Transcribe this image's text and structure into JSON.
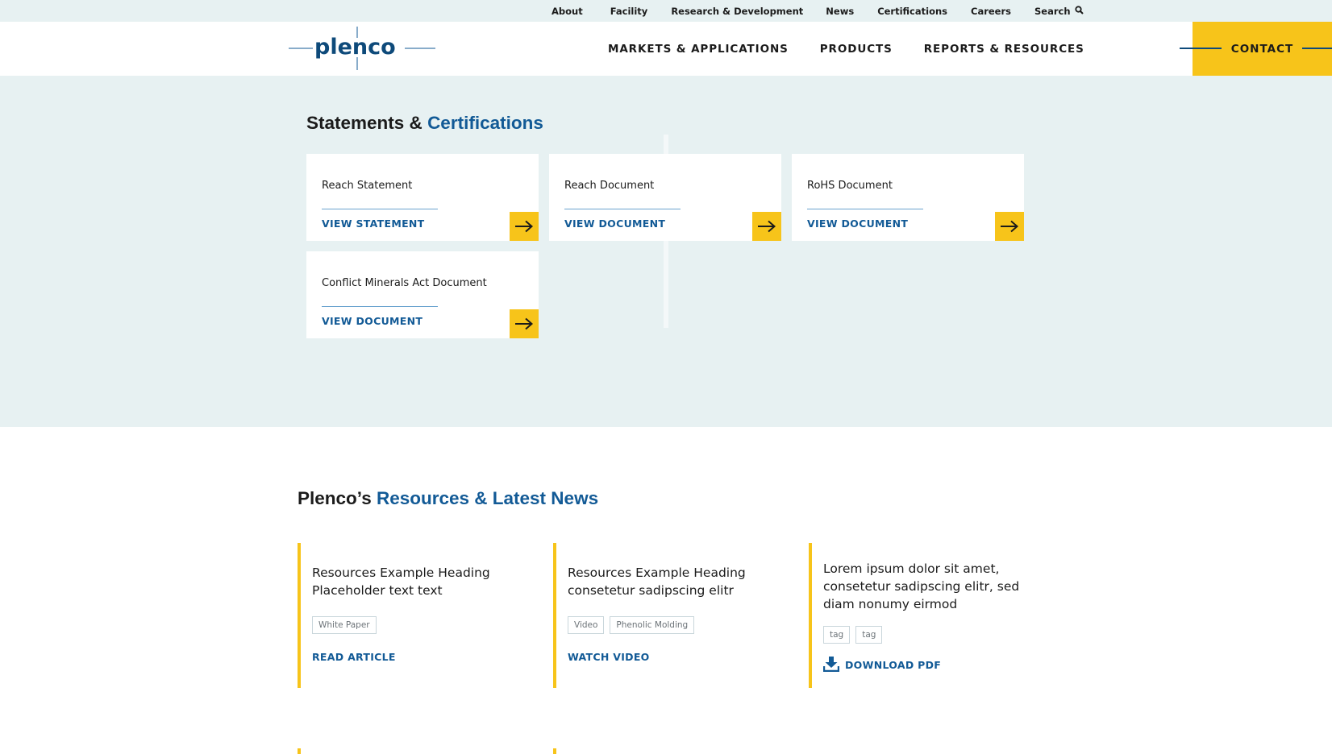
{
  "utility_nav": {
    "items": [
      "About",
      "Facility",
      "Research & Development",
      "News",
      "Certifications",
      "Careers"
    ],
    "search_label": "Search"
  },
  "header": {
    "logo_text": "plenco",
    "nav": [
      "MARKETS & APPLICATIONS",
      "PRODUCTS",
      "REPORTS & RESOURCES"
    ],
    "contact_label": "CONTACT"
  },
  "statements": {
    "title_prefix": "Statements &",
    "title_accent": "Certifications",
    "cards": [
      {
        "title": "Reach Statement",
        "link": "VIEW STATEMENT"
      },
      {
        "title": "Reach Document",
        "link": "VIEW DOCUMENT"
      },
      {
        "title": "RoHS Document",
        "link": "VIEW DOCUMENT"
      },
      {
        "title": "Conflict Minerals Act Document",
        "link": "VIEW DOCUMENT"
      }
    ]
  },
  "resources": {
    "title_prefix": "Plenco’s",
    "title_accent": "Resources & Latest News",
    "cards": [
      {
        "heading": "Resources Example Heading Placeholder text text",
        "tags": [
          "White Paper"
        ],
        "link": "READ ARTICLE"
      },
      {
        "heading": "Resources Example Heading consetetur sadipscing elitr",
        "tags": [
          "Video",
          "Phenolic Molding"
        ],
        "link": "WATCH VIDEO"
      },
      {
        "heading": "Lorem ipsum dolor sit amet, consetetur sadipscing elitr, sed diam nonumy eirmod",
        "tags": [
          "tag",
          "tag"
        ],
        "link": "DOWNLOAD PDF",
        "link_icon": "download-icon"
      }
    ]
  },
  "colors": {
    "accent_yellow": "#f7c41a",
    "brand_blue": "#125a96",
    "section_bg": "#e7f1f2"
  },
  "icons": {
    "search": "search-icon",
    "arrow": "arrow-right-icon",
    "download": "download-icon"
  }
}
